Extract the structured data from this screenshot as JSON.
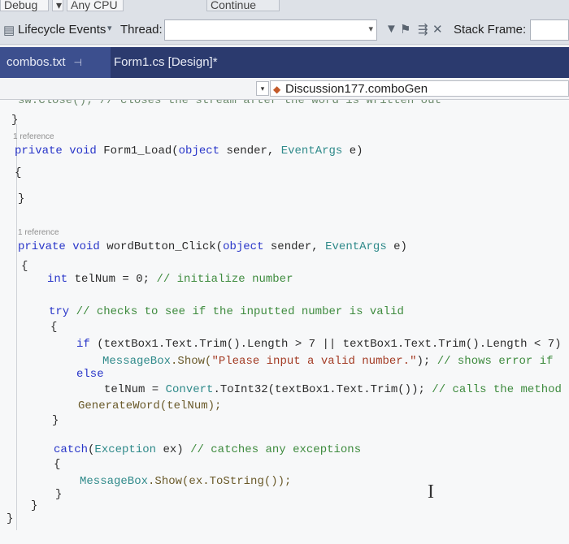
{
  "toolbar": {
    "debug_label": "Debug",
    "platform_label": "Any CPU",
    "continue_label": "Continue",
    "lifecycle_label": "Lifecycle Events",
    "thread_label": "Thread:",
    "stack_label": "Stack Frame:"
  },
  "tabs": [
    {
      "label": "combos.txt",
      "pin": "⊣"
    },
    {
      "label": "Form1.cs [Design]*"
    }
  ],
  "member_dropdown": {
    "value": "Discussion177.comboGen"
  },
  "code": {
    "top_comment": "sw.Close(); // closes the stream after the word is written out",
    "brace_close_top": "}",
    "ref1": "1 reference",
    "sig1_private": "private",
    "sig1_void": "void",
    "sig1_name": "Form1_Load(",
    "sig1_object": "object",
    "sig1_sender": "sender,",
    "sig1_eventargs": "EventArgs",
    "sig1_e": "e)",
    "brace_open1": "{",
    "brace_close1": "}",
    "ref2": "1 reference",
    "sig2_private": "private",
    "sig2_void": "void",
    "sig2_name": "wordButton_Click(",
    "sig2_object": "object",
    "sig2_sender": "sender,",
    "sig2_eventargs": "EventArgs",
    "sig2_e": "e)",
    "brace_open2": "{",
    "int_kw": "int",
    "int_stmt": "telNum = 0;",
    "int_comment": "// initialize number",
    "try_kw": "try",
    "try_comment": "// checks to see if the inputted number is valid",
    "brace_open3": "{",
    "if_kw": "if",
    "if_cond": "(textBox1.Text.Trim().Length > 7 || textBox1.Text.Trim().Length < 7)",
    "msg_class": "MessageBox",
    "msg_call": ".Show(",
    "msg_str": "\"Please input a valid number.\"",
    "msg_end": ");",
    "msg_comment": "// shows error if",
    "else_kw": "else",
    "conv_lhs": "telNum =",
    "conv_class": "Convert",
    "conv_rest": ".ToInt32(textBox1.Text.Trim());",
    "conv_comment": "// calls the method",
    "gen_call": "GenerateWord(telNum);",
    "brace_close3": "}",
    "catch_kw": "catch",
    "catch_open": "(",
    "catch_type": "Exception",
    "catch_var": "ex)",
    "catch_comment": "// catches any exceptions",
    "brace_open4": "{",
    "catch_msg_class": "MessageBox",
    "catch_msg_rest": ".Show(ex.ToString());",
    "brace_close4": "}",
    "brace_close5": "}",
    "brace_close6": "}"
  }
}
